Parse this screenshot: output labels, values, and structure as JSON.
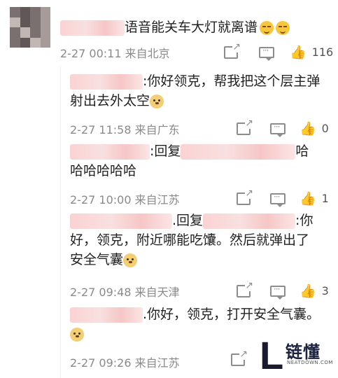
{
  "comment": {
    "text": "语音能关车大灯就离谱",
    "meta": "2-27 00:11 来自北京",
    "like_count": "116"
  },
  "replies": [
    {
      "line1": ":你好领克，帮我把这个层主弹",
      "line2": "射出去外太空",
      "meta": "2-27 11:58 来自广东",
      "like_count": "0"
    },
    {
      "prefix": ":回复",
      "suffix": "哈",
      "line2": "哈哈哈哈哈",
      "meta": "2-27 10:00 来自江苏",
      "like_count": "1"
    },
    {
      "prefix": ".回复",
      "suffix": ":你",
      "line2": "好，领克，附近哪能吃馕。然后就弹出了",
      "line3": "安全气囊",
      "meta": "2-27 09:48 来自天津",
      "like_count": "3"
    },
    {
      "line1": ".你好，领克，打开安全气囊。",
      "meta": "2-27 09:26 来自江苏"
    }
  ],
  "watermark": {
    "letter": "L",
    "name": "链懂",
    "url": "NEATDOWN.COM"
  },
  "icons": {
    "share": "share-icon",
    "comment": "comment-icon",
    "like": "thumbs-up-icon"
  }
}
